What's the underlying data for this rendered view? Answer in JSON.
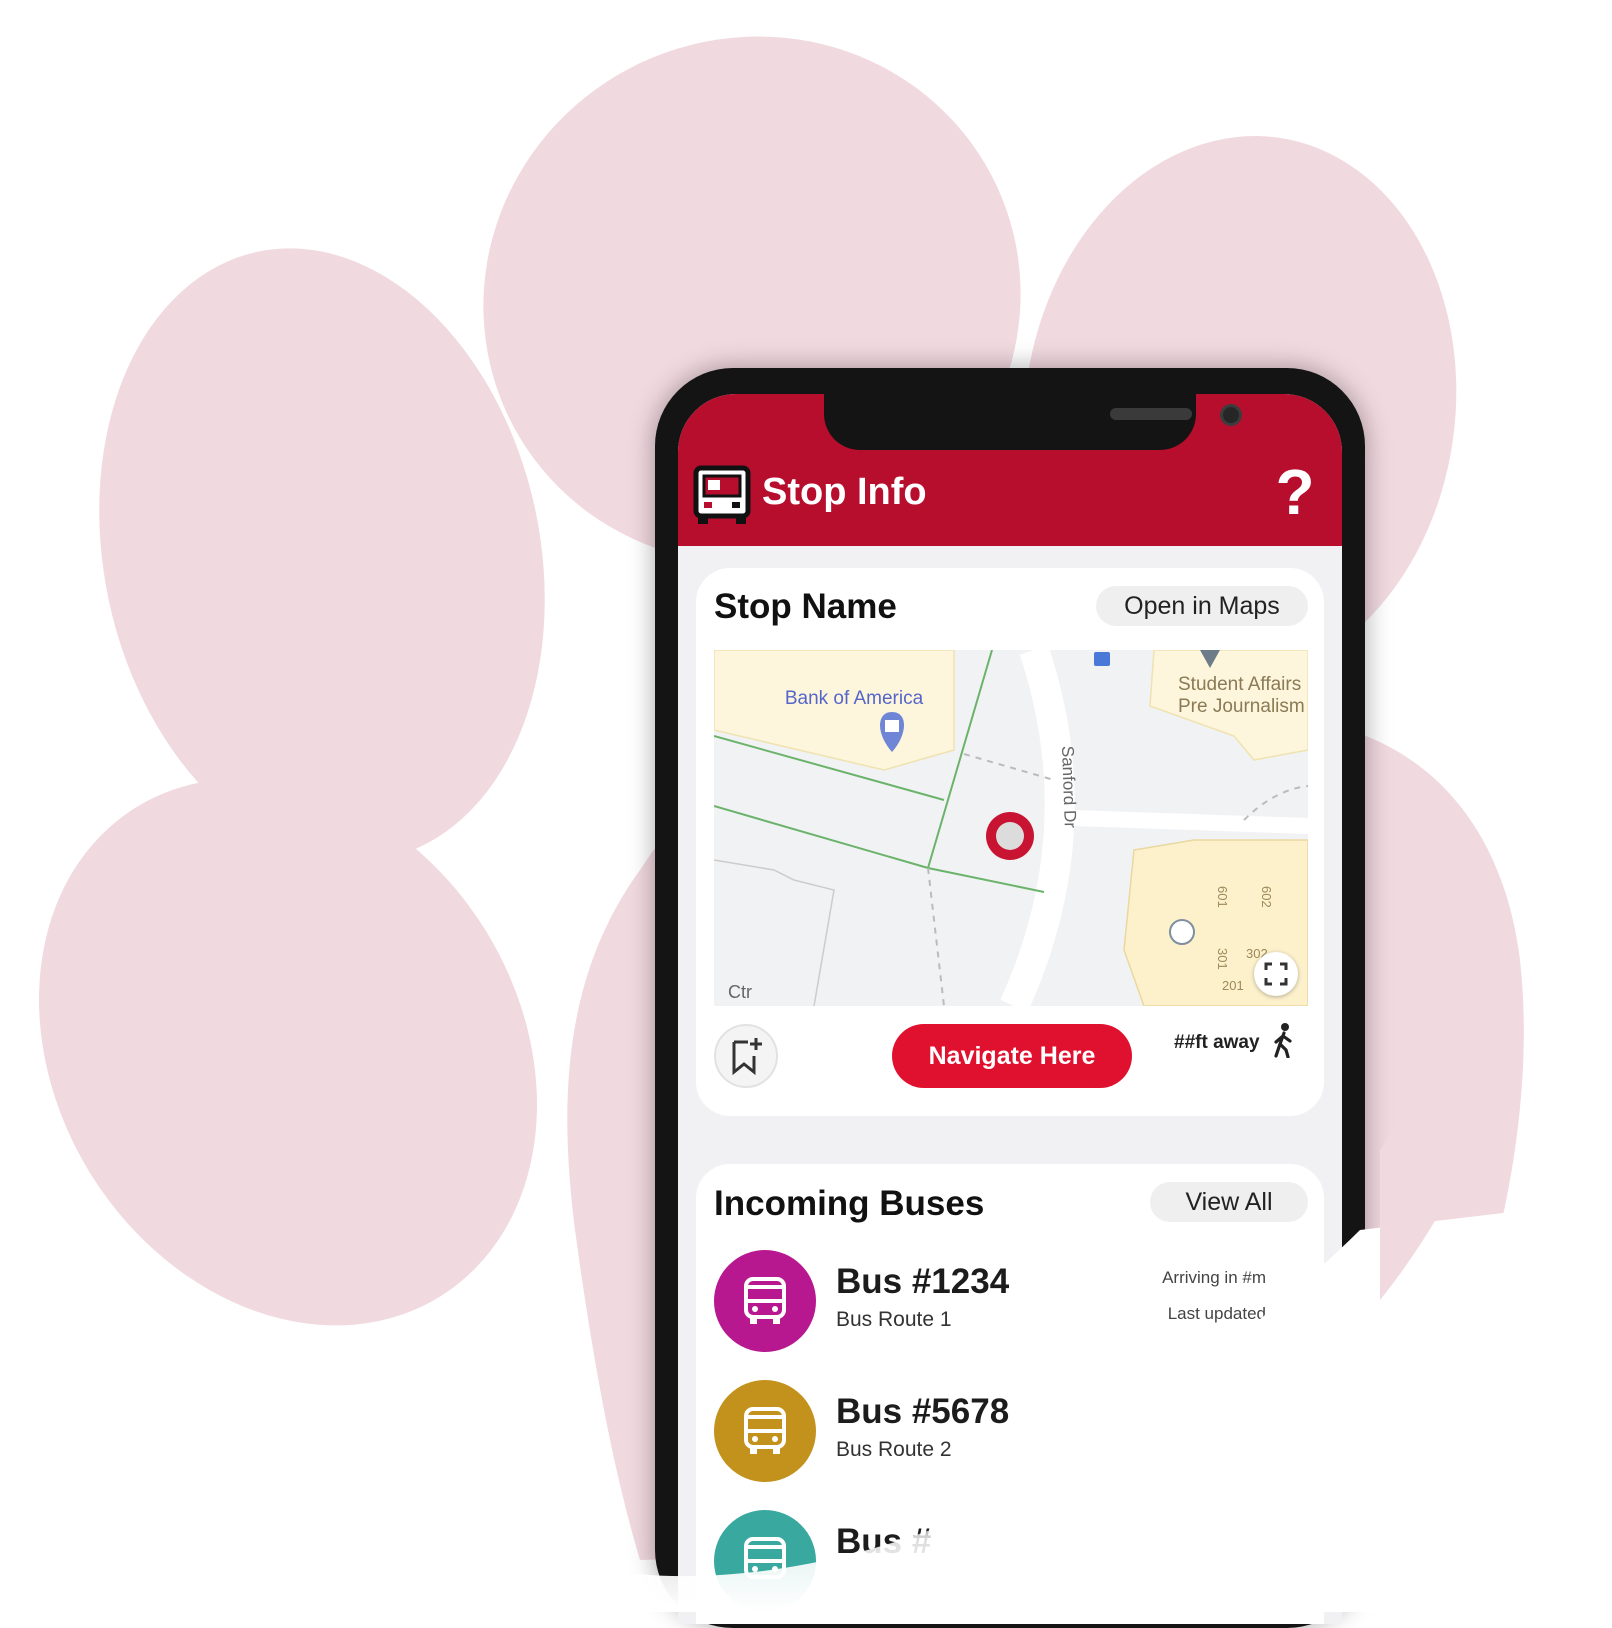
{
  "app": {
    "title": "Stop Info",
    "help_label": "?",
    "accent_color": "#b70e2e",
    "background_shape_color": "#f1d9e0"
  },
  "stop_card": {
    "title": "Stop Name",
    "open_maps_label": "Open in Maps",
    "map": {
      "labels": {
        "bank": "Bank of America",
        "student_affairs": "Student Affairs",
        "journalism": "Pre Journalism",
        "street": "Sanford Dr",
        "ctr": "Ctr",
        "room_601": "601",
        "room_602": "602",
        "room_301": "301",
        "room_302": "302",
        "room_201": "201"
      }
    },
    "navigate_label": "Navigate Here",
    "distance_text": "##ft away"
  },
  "buses_card": {
    "title": "Incoming Buses",
    "view_all_label": "View All",
    "buses": [
      {
        "number": "Bus #1234",
        "route": "Bus Route 1",
        "arriving": "Arriving in #m",
        "updated": "Last updated",
        "color": "#b8188f"
      },
      {
        "number": "Bus #5678",
        "route": "Bus Route 2",
        "color": "#c3921d"
      },
      {
        "number": "Bus #",
        "color": "#39a89e"
      }
    ]
  },
  "icons": [
    "bus-stop-logo-icon",
    "help-icon",
    "bank-marker-icon",
    "stop-marker-icon",
    "expand-map-icon",
    "bookmark-add-icon",
    "walking-icon",
    "bus-icon"
  ]
}
